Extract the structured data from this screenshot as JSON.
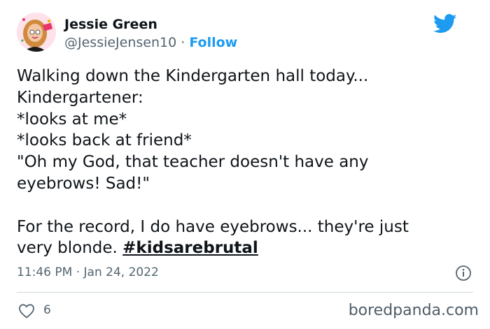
{
  "tweet": {
    "author_name": "Jessie Green",
    "author_handle": "@JessieJensen10",
    "separator": " · ",
    "follow_label": "Follow",
    "lines": [
      "Walking down the Kindergarten hall today...",
      "Kindergartener:",
      "*looks at me*",
      "*looks back at friend*",
      "\"Oh my God, that teacher doesn't have any",
      "eyebrows! Sad!\""
    ],
    "paragraph2_line1": "For the record, I do have eyebrows... they're just",
    "paragraph2_line2_prefix": "very blonde. ",
    "hashtag": "#kidsarebrutal",
    "time": "11:46 PM",
    "date": "Jan 24, 2022",
    "like_count": "6"
  },
  "icons": {
    "brand": "twitter-bird-icon",
    "info": "info-icon",
    "like": "heart-outline-icon"
  },
  "colors": {
    "twitter_blue": "#1d9bf0",
    "text": "#0f1419",
    "muted": "#536471"
  },
  "watermark": "boredpanda.com"
}
